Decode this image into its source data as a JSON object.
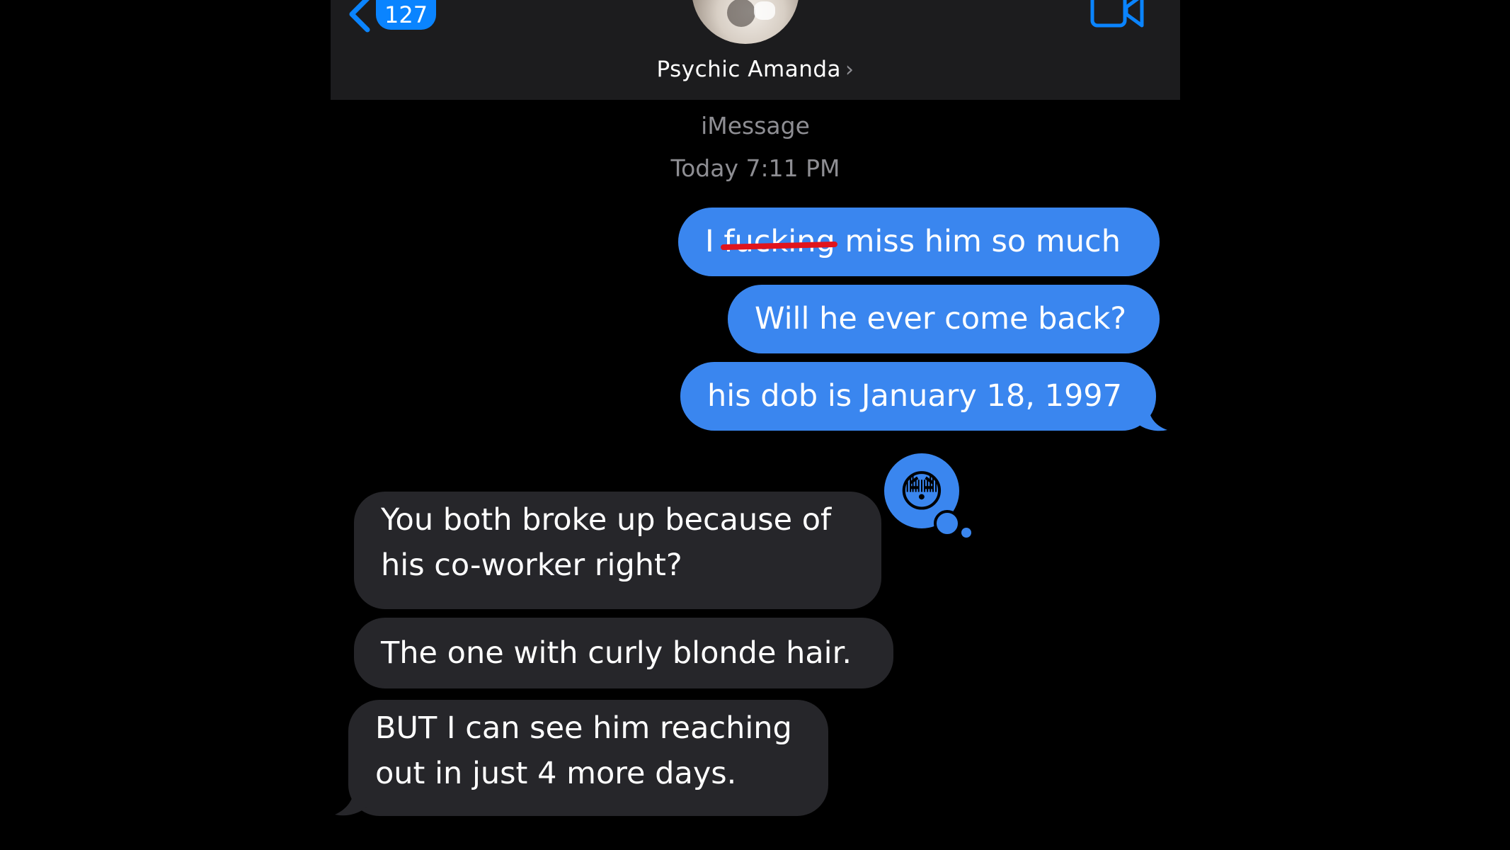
{
  "header": {
    "unread_count": "127",
    "contact_name": "Psychic Amanda",
    "name_chevron": "›"
  },
  "thread": {
    "service": "iMessage",
    "timestamp": "Today 7:11 PM"
  },
  "messages": [
    {
      "direction": "outgoing",
      "prefix": "I",
      "struck_word": "fucking",
      "suffix": "miss him so much"
    },
    {
      "direction": "outgoing",
      "text": "Will he ever come back?"
    },
    {
      "direction": "outgoing",
      "text": "his dob is January 18, 1997"
    },
    {
      "direction": "incoming",
      "lines": [
        "You both broke up because of",
        "his co-worker right?"
      ],
      "tapback": "😳"
    },
    {
      "direction": "incoming",
      "text": "The one with curly blonde hair."
    },
    {
      "direction": "incoming",
      "lines": [
        "BUT I can see him reaching",
        "out in just 4 more days."
      ]
    }
  ],
  "colors": {
    "background": "#000000",
    "navbar": "#1c1c1e",
    "outgoing_bubble": "#3a86ef",
    "incoming_bubble": "#26262a",
    "accent": "#0a84ff",
    "strike": "#e0141c",
    "secondary_text": "#8e8e93"
  },
  "icons": [
    "back-chevron-icon",
    "video-camera-icon",
    "flushed-face-emoji"
  ]
}
